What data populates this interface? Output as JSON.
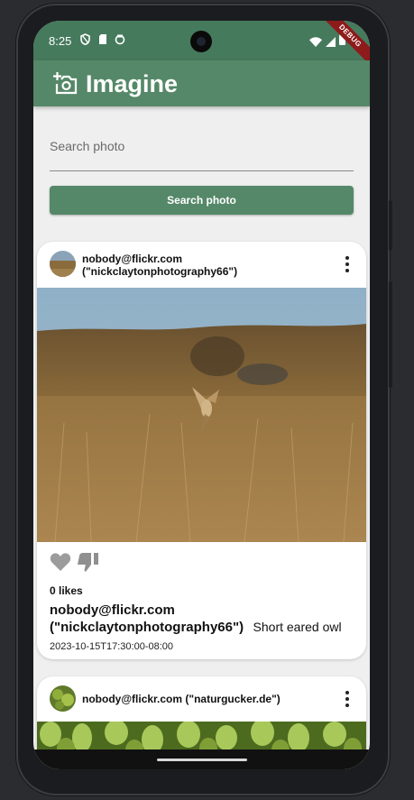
{
  "status": {
    "time": "8:25",
    "debug_label": "DEBUG"
  },
  "app": {
    "title": "Imagine"
  },
  "search": {
    "placeholder": "Search photo",
    "value": "",
    "button_label": "Search photo"
  },
  "posts": [
    {
      "author_line1": "nobody@flickr.com",
      "author_line2": "(\"nickclaytonphotography66\")",
      "likes_label": "0 likes",
      "caption_author_line1": "nobody@flickr.com",
      "caption_author_line2": "(\"nickclaytonphotography66\")",
      "caption_title": "Short eared owl",
      "date": "2023-10-15T17:30:00-08:00"
    },
    {
      "author_line1": "nobody@flickr.com (\"naturgucker.de\")"
    }
  ],
  "colors": {
    "app_bar": "#558868",
    "status_bar": "#467a5d",
    "button": "#558868"
  }
}
